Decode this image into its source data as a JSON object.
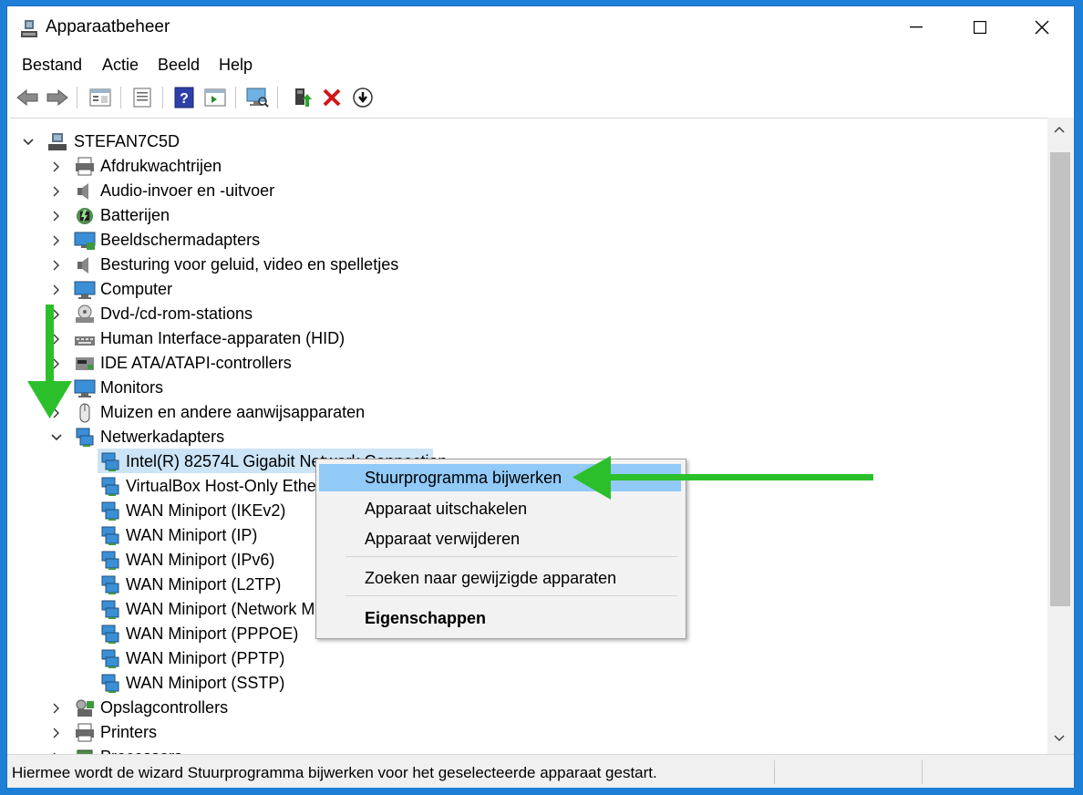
{
  "window": {
    "title": "Apparaatbeheer"
  },
  "menu": [
    "Bestand",
    "Actie",
    "Beeld",
    "Help"
  ],
  "tree": {
    "root": "STEFAN7C5D",
    "categories": [
      {
        "label": "Afdrukwachtrijen",
        "icon": "printer-queue-icon"
      },
      {
        "label": "Audio-invoer en -uitvoer",
        "icon": "speaker-icon"
      },
      {
        "label": "Batterijen",
        "icon": "battery-icon"
      },
      {
        "label": "Beeldschermadapters",
        "icon": "display-adapter-icon"
      },
      {
        "label": "Besturing voor geluid, video en spelletjes",
        "icon": "speaker-icon"
      },
      {
        "label": "Computer",
        "icon": "monitor-icon"
      },
      {
        "label": "Dvd-/cd-rom-stations",
        "icon": "disc-drive-icon"
      },
      {
        "label": "Human Interface-apparaten (HID)",
        "icon": "keyboard-icon"
      },
      {
        "label": "IDE ATA/ATAPI-controllers",
        "icon": "controller-icon"
      },
      {
        "label": "Monitors",
        "icon": "monitor-icon"
      },
      {
        "label": "Muizen en andere aanwijsapparaten",
        "icon": "mouse-icon"
      },
      {
        "label": "Netwerkadapters",
        "icon": "network-icon",
        "expanded": true
      }
    ],
    "network_children": [
      "Intel(R) 82574L Gigabit Network Connection",
      "VirtualBox Host-Only Ethern",
      "WAN Miniport (IKEv2)",
      "WAN Miniport (IP)",
      "WAN Miniport (IPv6)",
      "WAN Miniport (L2TP)",
      "WAN Miniport (Network Mo",
      "WAN Miniport (PPPOE)",
      "WAN Miniport (PPTP)",
      "WAN Miniport (SSTP)"
    ],
    "after": [
      {
        "label": "Opslagcontrollers",
        "icon": "storage-icon"
      },
      {
        "label": "Printers",
        "icon": "printer-icon"
      },
      {
        "label": "Processors",
        "icon": "processor-icon"
      }
    ]
  },
  "context_menu": {
    "items": [
      "Stuurprogramma bijwerken",
      "Apparaat uitschakelen",
      "Apparaat verwijderen",
      "Zoeken naar gewijzigde apparaten",
      "Eigenschappen"
    ],
    "highlighted": "Stuurprogramma bijwerken"
  },
  "status": "Hiermee wordt de wizard Stuurprogramma bijwerken voor het geselecteerde apparaat gestart.",
  "colors": {
    "accent": "#1e7fd6",
    "highlight": "#91c9f7",
    "selection": "#cce4f7",
    "annotation_arrow": "#2bc02b"
  }
}
